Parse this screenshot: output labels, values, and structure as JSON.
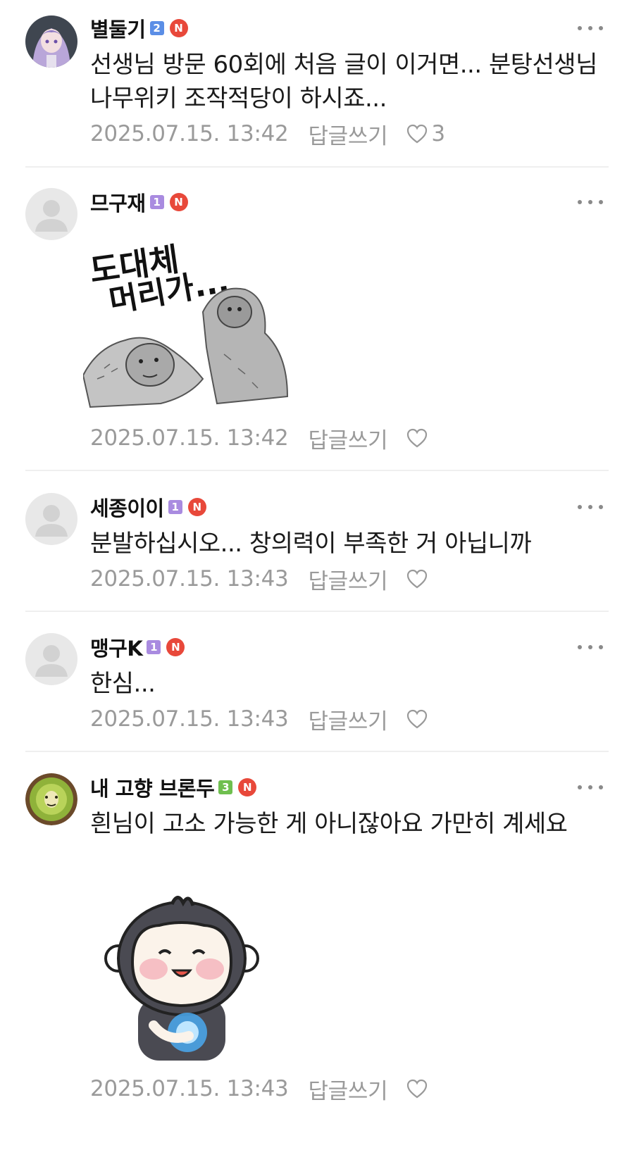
{
  "comments": [
    {
      "nickname": "별둘기",
      "level": "2",
      "level_color": "#5b8ee6",
      "new_badge": "N",
      "text": "선생님 방문 60회에 처음 글이 이거면... 분탕선생님 나무위키 조작적당이 하시죠...",
      "date": "2025.07.15. 13:42",
      "reply_label": "답글쓰기",
      "likes": "3"
    },
    {
      "nickname": "므구재",
      "level": "1",
      "level_color": "#a98be0",
      "new_badge": "N",
      "sticker_text": [
        "도대체",
        "머리가..."
      ],
      "date": "2025.07.15. 13:42",
      "reply_label": "답글쓰기",
      "likes": ""
    },
    {
      "nickname": "세종이이",
      "level": "1",
      "level_color": "#a98be0",
      "new_badge": "N",
      "text": "분발하십시오... 창의력이 부족한 거 아닙니까",
      "date": "2025.07.15. 13:43",
      "reply_label": "답글쓰기",
      "likes": ""
    },
    {
      "nickname": "맹구K",
      "level": "1",
      "level_color": "#a98be0",
      "new_badge": "N",
      "text": "한심...",
      "date": "2025.07.15. 13:43",
      "reply_label": "답글쓰기",
      "likes": ""
    },
    {
      "nickname": "내 고향 브론두",
      "level": "3",
      "level_color": "#6fbf4f",
      "new_badge": "N",
      "text": "흰님이 고소 가능한 게 아니잖아요 가만히 계세요",
      "date": "2025.07.15. 13:43",
      "reply_label": "답글쓰기",
      "likes": ""
    }
  ],
  "colors": {
    "meta": "#9a9a9a",
    "new_badge": "#e8483a",
    "divider": "#efefef"
  }
}
